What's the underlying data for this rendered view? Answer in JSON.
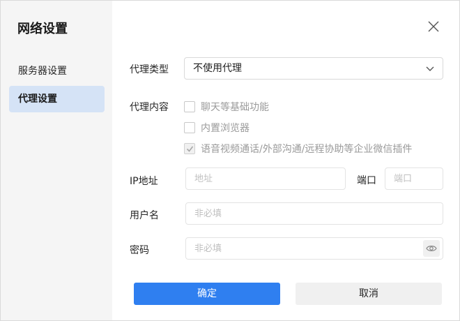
{
  "dialog": {
    "title": "网络设置",
    "close_icon": "close-icon"
  },
  "sidebar": {
    "items": [
      {
        "label": "服务器设置",
        "active": false
      },
      {
        "label": "代理设置",
        "active": true
      }
    ]
  },
  "proxy_type": {
    "label": "代理类型",
    "value": "不使用代理"
  },
  "proxy_content": {
    "label": "代理内容",
    "options": [
      {
        "label": "聊天等基础功能",
        "checked": false
      },
      {
        "label": "内置浏览器",
        "checked": false
      },
      {
        "label": "语音视频通话/外部沟通/远程协助等企业微信插件",
        "checked": true
      }
    ]
  },
  "ip": {
    "label": "IP地址",
    "placeholder": "地址",
    "port_label": "端口",
    "port_placeholder": "端口"
  },
  "username": {
    "label": "用户名",
    "placeholder": "非必填"
  },
  "password": {
    "label": "密码",
    "placeholder": "非必填",
    "toggle_icon": "eye-icon"
  },
  "buttons": {
    "confirm": "确定",
    "cancel": "取消"
  },
  "colors": {
    "primary": "#2f7ff0",
    "sidebar_bg": "#f5f5f5",
    "active_nav": "#d5e3f6"
  }
}
